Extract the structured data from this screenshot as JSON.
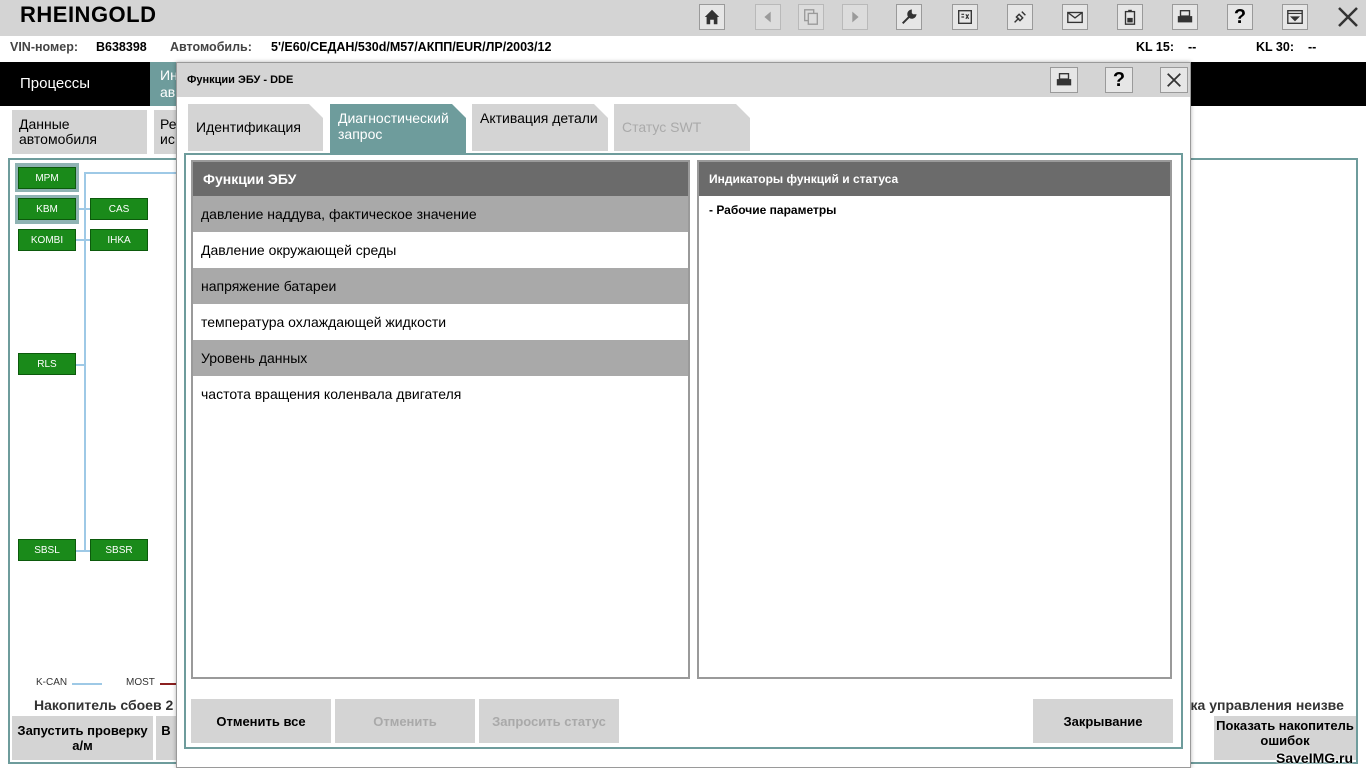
{
  "app": {
    "brand": "RHEINGOLD"
  },
  "toolbar": {
    "home": "home-icon",
    "back": "back-icon",
    "copy": "copy-icon",
    "forward": "forward-icon",
    "service": "wrench-icon",
    "vci": "vci-icon",
    "plug": "plug-icon",
    "mail": "mail-icon",
    "battery": "battery-icon",
    "print": "print-icon",
    "help_label": "?",
    "show": "window-icon",
    "close": "close-icon"
  },
  "vehicle": {
    "vin_label": "VIN-номер:",
    "vin_value": "B638398",
    "car_label": "Автомобиль:",
    "car_value": "5'/E60/СЕДАН/530d/M57/АКПП/EUR/ЛР/2003/12",
    "kl15_label": "KL 15:",
    "kl15_value": "--",
    "kl30_label": "KL 30:",
    "kl30_value": "--"
  },
  "process_bar": {
    "item1": "Процессы",
    "item2": "Ин ав"
  },
  "sub_tabs": {
    "tab1": "Данные автомобиля",
    "tab2": "Ре ис"
  },
  "ecus": [
    "MPM",
    "KBM",
    "CAS",
    "KOMBI",
    "IHKA",
    "RLS",
    "SBSL",
    "SBSR"
  ],
  "legend": {
    "kcan": "K-CAN",
    "most": "MOST",
    "kcan_color": "#9ec9e6",
    "most_color": "#8b2020"
  },
  "background_status": {
    "left": "Накопитель сбоев 2",
    "right": "ока управления неизве"
  },
  "background_buttons": {
    "start_check": "Запустить проверку а/м",
    "b2": "В",
    "show_memory": "Показать накопитель ошибок"
  },
  "dialog": {
    "title": "Функции ЭБУ - DDE",
    "icons": {
      "print": "print-icon",
      "help": "?",
      "close": "close-icon"
    },
    "tabs": [
      {
        "label": "Идентификация"
      },
      {
        "label": "Диагностический запрос"
      },
      {
        "label": "Активация детали"
      },
      {
        "label": "Статус SWT"
      }
    ],
    "functions_header": "Функции ЭБУ",
    "functions": [
      "давление наддува, фактическое значение",
      "Давление окружающей среды",
      "напряжение батареи",
      "температура охлаждающей жидкости",
      "Уровень данных",
      "частота вращения коленвала двигателя"
    ],
    "status_header": "Индикаторы функций и статуса",
    "status_items": [
      "- Рабочие параметры"
    ],
    "buttons": {
      "cancel_all": "Отменить все",
      "cancel": "Отменить",
      "request_status": "Запросить статус",
      "close": "Закрывание"
    }
  },
  "colors": {
    "accent": "#6e9c9c",
    "header_bg": "#d4d4d4",
    "ecu_green": "#1a8a1a",
    "panel_head": "#6b6b6b"
  },
  "watermark": "SaveIMG.ru"
}
